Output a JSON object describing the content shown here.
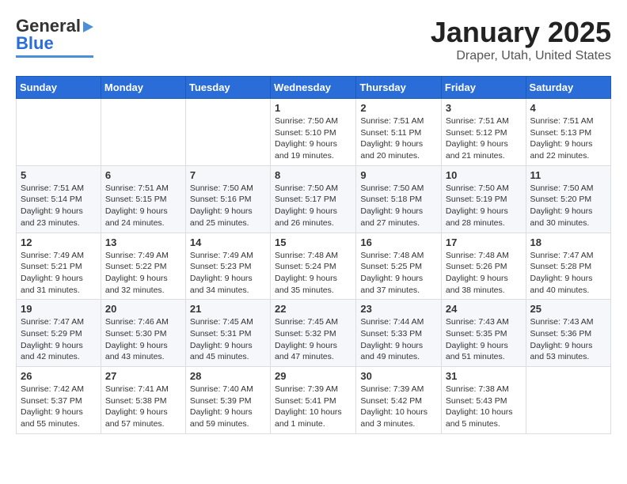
{
  "header": {
    "logo_general": "General",
    "logo_blue": "Blue",
    "month": "January 2025",
    "location": "Draper, Utah, United States"
  },
  "days_of_week": [
    "Sunday",
    "Monday",
    "Tuesday",
    "Wednesday",
    "Thursday",
    "Friday",
    "Saturday"
  ],
  "weeks": [
    [
      {
        "day": "",
        "detail": ""
      },
      {
        "day": "",
        "detail": ""
      },
      {
        "day": "",
        "detail": ""
      },
      {
        "day": "1",
        "detail": "Sunrise: 7:50 AM\nSunset: 5:10 PM\nDaylight: 9 hours\nand 19 minutes."
      },
      {
        "day": "2",
        "detail": "Sunrise: 7:51 AM\nSunset: 5:11 PM\nDaylight: 9 hours\nand 20 minutes."
      },
      {
        "day": "3",
        "detail": "Sunrise: 7:51 AM\nSunset: 5:12 PM\nDaylight: 9 hours\nand 21 minutes."
      },
      {
        "day": "4",
        "detail": "Sunrise: 7:51 AM\nSunset: 5:13 PM\nDaylight: 9 hours\nand 22 minutes."
      }
    ],
    [
      {
        "day": "5",
        "detail": "Sunrise: 7:51 AM\nSunset: 5:14 PM\nDaylight: 9 hours\nand 23 minutes."
      },
      {
        "day": "6",
        "detail": "Sunrise: 7:51 AM\nSunset: 5:15 PM\nDaylight: 9 hours\nand 24 minutes."
      },
      {
        "day": "7",
        "detail": "Sunrise: 7:50 AM\nSunset: 5:16 PM\nDaylight: 9 hours\nand 25 minutes."
      },
      {
        "day": "8",
        "detail": "Sunrise: 7:50 AM\nSunset: 5:17 PM\nDaylight: 9 hours\nand 26 minutes."
      },
      {
        "day": "9",
        "detail": "Sunrise: 7:50 AM\nSunset: 5:18 PM\nDaylight: 9 hours\nand 27 minutes."
      },
      {
        "day": "10",
        "detail": "Sunrise: 7:50 AM\nSunset: 5:19 PM\nDaylight: 9 hours\nand 28 minutes."
      },
      {
        "day": "11",
        "detail": "Sunrise: 7:50 AM\nSunset: 5:20 PM\nDaylight: 9 hours\nand 30 minutes."
      }
    ],
    [
      {
        "day": "12",
        "detail": "Sunrise: 7:49 AM\nSunset: 5:21 PM\nDaylight: 9 hours\nand 31 minutes."
      },
      {
        "day": "13",
        "detail": "Sunrise: 7:49 AM\nSunset: 5:22 PM\nDaylight: 9 hours\nand 32 minutes."
      },
      {
        "day": "14",
        "detail": "Sunrise: 7:49 AM\nSunset: 5:23 PM\nDaylight: 9 hours\nand 34 minutes."
      },
      {
        "day": "15",
        "detail": "Sunrise: 7:48 AM\nSunset: 5:24 PM\nDaylight: 9 hours\nand 35 minutes."
      },
      {
        "day": "16",
        "detail": "Sunrise: 7:48 AM\nSunset: 5:25 PM\nDaylight: 9 hours\nand 37 minutes."
      },
      {
        "day": "17",
        "detail": "Sunrise: 7:48 AM\nSunset: 5:26 PM\nDaylight: 9 hours\nand 38 minutes."
      },
      {
        "day": "18",
        "detail": "Sunrise: 7:47 AM\nSunset: 5:28 PM\nDaylight: 9 hours\nand 40 minutes."
      }
    ],
    [
      {
        "day": "19",
        "detail": "Sunrise: 7:47 AM\nSunset: 5:29 PM\nDaylight: 9 hours\nand 42 minutes."
      },
      {
        "day": "20",
        "detail": "Sunrise: 7:46 AM\nSunset: 5:30 PM\nDaylight: 9 hours\nand 43 minutes."
      },
      {
        "day": "21",
        "detail": "Sunrise: 7:45 AM\nSunset: 5:31 PM\nDaylight: 9 hours\nand 45 minutes."
      },
      {
        "day": "22",
        "detail": "Sunrise: 7:45 AM\nSunset: 5:32 PM\nDaylight: 9 hours\nand 47 minutes."
      },
      {
        "day": "23",
        "detail": "Sunrise: 7:44 AM\nSunset: 5:33 PM\nDaylight: 9 hours\nand 49 minutes."
      },
      {
        "day": "24",
        "detail": "Sunrise: 7:43 AM\nSunset: 5:35 PM\nDaylight: 9 hours\nand 51 minutes."
      },
      {
        "day": "25",
        "detail": "Sunrise: 7:43 AM\nSunset: 5:36 PM\nDaylight: 9 hours\nand 53 minutes."
      }
    ],
    [
      {
        "day": "26",
        "detail": "Sunrise: 7:42 AM\nSunset: 5:37 PM\nDaylight: 9 hours\nand 55 minutes."
      },
      {
        "day": "27",
        "detail": "Sunrise: 7:41 AM\nSunset: 5:38 PM\nDaylight: 9 hours\nand 57 minutes."
      },
      {
        "day": "28",
        "detail": "Sunrise: 7:40 AM\nSunset: 5:39 PM\nDaylight: 9 hours\nand 59 minutes."
      },
      {
        "day": "29",
        "detail": "Sunrise: 7:39 AM\nSunset: 5:41 PM\nDaylight: 10 hours\nand 1 minute."
      },
      {
        "day": "30",
        "detail": "Sunrise: 7:39 AM\nSunset: 5:42 PM\nDaylight: 10 hours\nand 3 minutes."
      },
      {
        "day": "31",
        "detail": "Sunrise: 7:38 AM\nSunset: 5:43 PM\nDaylight: 10 hours\nand 5 minutes."
      },
      {
        "day": "",
        "detail": ""
      }
    ]
  ]
}
